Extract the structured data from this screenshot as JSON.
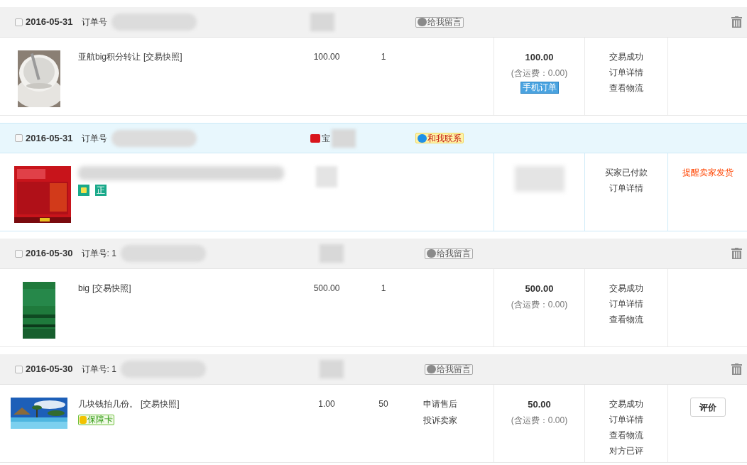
{
  "orders": [
    {
      "kind": "normal",
      "checked": false,
      "date": "2016-05-31",
      "order_label": "订单号",
      "message": {
        "kind": "message",
        "label": "给我留言"
      },
      "deletable": true,
      "items": [
        {
          "title": "亚航big积分转让",
          "snapshot": "[交易快照]",
          "price": "100.00",
          "qty": "1"
        }
      ],
      "total": "100.00",
      "shipping": "(含运费：0.00)",
      "mobile_badge": "手机订单",
      "status": [
        "交易成功",
        "订单详情",
        "查看物流"
      ]
    },
    {
      "kind": "tmall",
      "checked": false,
      "date": "2016-05-31",
      "order_label": "订单号",
      "shop": "宝",
      "message": {
        "kind": "contact",
        "label": "和我联系"
      },
      "deletable": false,
      "items": [
        {
          "badges": [
            {
              "kind": "bag"
            },
            {
              "kind": "text",
              "label": "正"
            }
          ]
        }
      ],
      "status": [
        "买家已付款",
        "订单详情"
      ],
      "action": {
        "kind": "link",
        "label": "提醒卖家发货"
      }
    },
    {
      "kind": "normal",
      "checked": false,
      "date": "2016-05-30",
      "order_label": "订单号: 1",
      "message": {
        "kind": "message",
        "label": "给我留言"
      },
      "deletable": true,
      "items": [
        {
          "title": "big",
          "snapshot": "[交易快照]",
          "price": "500.00",
          "qty": "1"
        }
      ],
      "total": "500.00",
      "shipping": "(含运费：0.00)",
      "status": [
        "交易成功",
        "订单详情",
        "查看物流"
      ]
    },
    {
      "kind": "normal",
      "checked": false,
      "date": "2016-05-30",
      "order_label": "订单号: 1",
      "message": {
        "kind": "message",
        "label": "给我留言"
      },
      "deletable": true,
      "items": [
        {
          "title": "几块钱拍几份。",
          "snapshot": "[交易快照]",
          "price": "1.00",
          "qty": "50",
          "badges": [
            {
              "kind": "card",
              "label": "保障卡"
            }
          ],
          "after_sale": [
            "申请售后",
            "投诉卖家"
          ]
        }
      ],
      "total": "50.00",
      "shipping": "(含运费：0.00)",
      "status": [
        "交易成功",
        "订单详情",
        "查看物流",
        "对方已评"
      ],
      "action": {
        "kind": "button",
        "label": "评价"
      }
    }
  ]
}
